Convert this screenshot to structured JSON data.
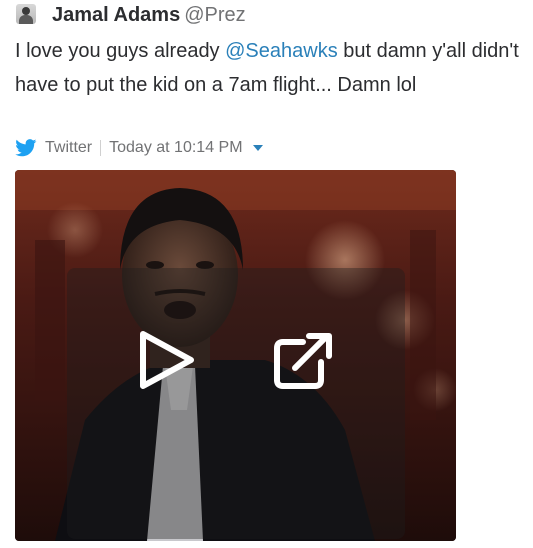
{
  "tweet": {
    "author_name": "Jamal Adams",
    "author_handle": "@Prez",
    "text_before": "I love you guys already ",
    "mention": "@Seahawks",
    "text_after": " but damn y'all didn't have to put the kid on a 7am flight... Damn lol",
    "mention_color": "#2a80b9"
  },
  "meta": {
    "source": "Twitter",
    "timestamp": "Today at 10:14 PM",
    "bird_icon": "twitter-bird-icon",
    "caret_icon": "caret-down-icon",
    "bird_color": "#1da1f2"
  },
  "media": {
    "type": "gif",
    "play_icon": "play-icon",
    "open_icon": "open-external-icon"
  }
}
